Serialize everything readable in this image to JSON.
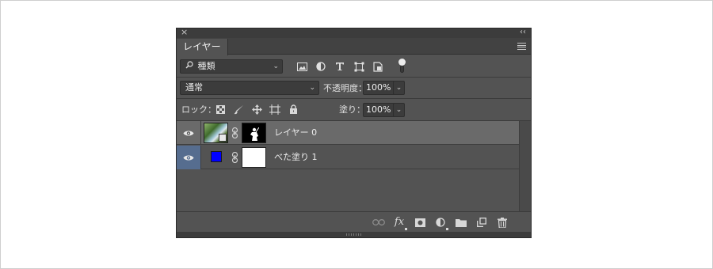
{
  "panel": {
    "close_glyph": "×",
    "collapse_glyph": "‹‹",
    "tab_label": "レイヤー",
    "menu_icon": "panel-menu-icon"
  },
  "filter": {
    "search_icon": "magnifier-icon",
    "kind_label": "種類",
    "icons": [
      "pixel-layer-filter-icon",
      "adjustment-layer-filter-icon",
      "type-layer-filter-icon",
      "shape-layer-filter-icon",
      "smart-object-filter-icon"
    ],
    "toggle_on": true
  },
  "blend": {
    "mode": "通常",
    "opacity_label": "不透明度：",
    "opacity_value": "100%"
  },
  "lock": {
    "label": "ロック：",
    "icons": [
      "lock-transparent-pixels-icon",
      "lock-image-pixels-icon",
      "lock-position-icon",
      "lock-artboard-icon",
      "lock-all-icon"
    ],
    "fill_label": "塗り：",
    "fill_value": "100%"
  },
  "layers": [
    {
      "name": "レイヤー 0",
      "visible": true,
      "selected": false,
      "type": "smart-object-with-mask"
    },
    {
      "name": "べた塗り 1",
      "visible": true,
      "selected": true,
      "type": "solid-color-fill",
      "color": "#0000ff"
    }
  ],
  "footer": {
    "icons": [
      "link-layers-icon",
      "fx-icon",
      "add-mask-icon",
      "adjustment-layer-icon",
      "new-group-icon",
      "new-layer-icon",
      "trash-icon"
    ],
    "fx_label": "fx"
  },
  "colors": {
    "panel_bg": "#535353",
    "selected_eye_bg": "#566d8f",
    "row_highlight": "#6a6a6a"
  }
}
